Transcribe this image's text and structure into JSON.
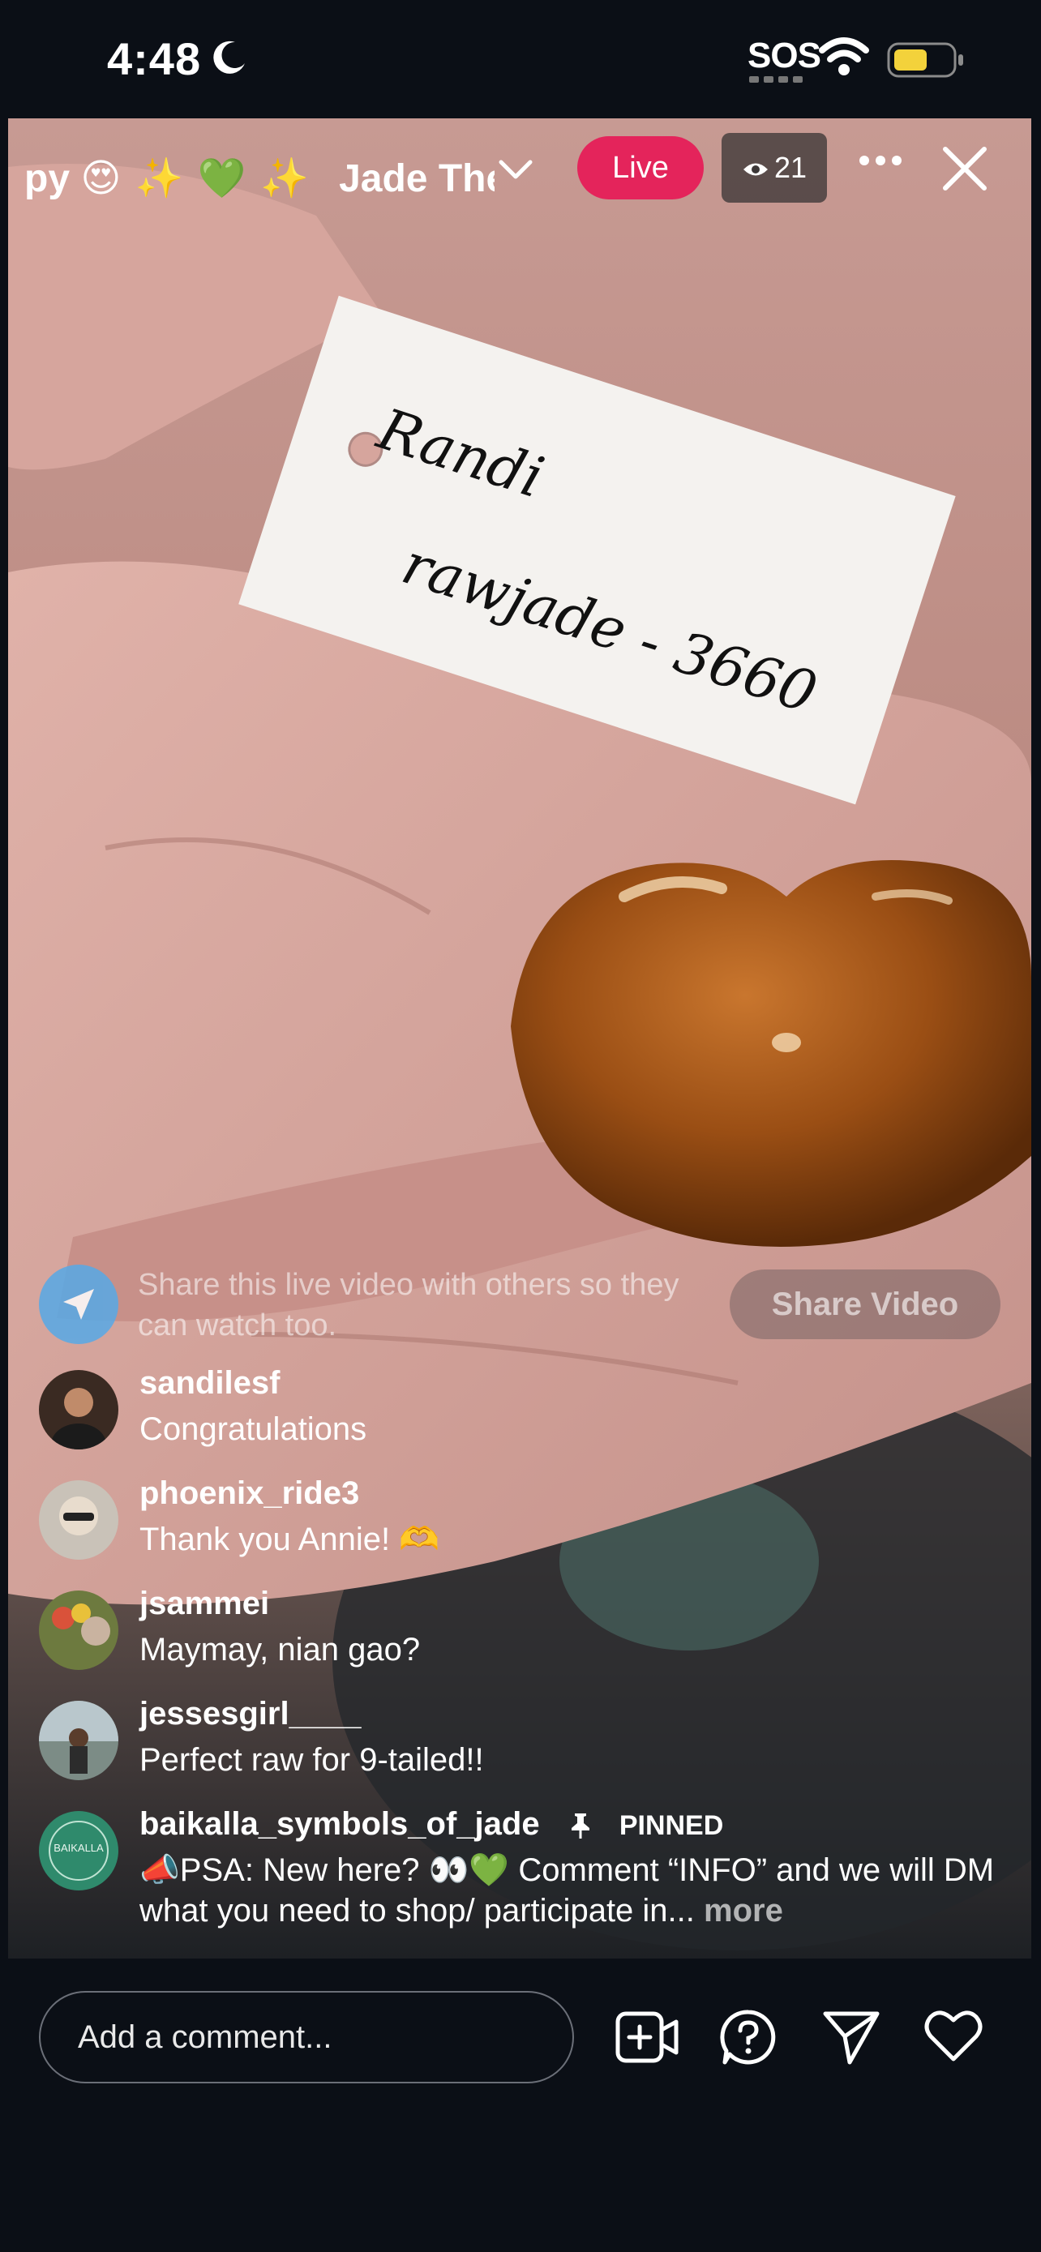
{
  "status_bar": {
    "time": "4:48",
    "sos": "SOS"
  },
  "live_header": {
    "scrolling_text": "py",
    "title": "Jade The",
    "live_label": "Live",
    "viewer_count": "21"
  },
  "video": {
    "tag_line_1": "Randi",
    "tag_line_2": "rawjade - 3660"
  },
  "share_prompt": {
    "text": "Share this live video with others so they can watch too.",
    "button": "Share Video"
  },
  "comments": [
    {
      "user": "sandilesf",
      "message": "Congratulations",
      "avatar_color": "#3a2a22"
    },
    {
      "user": "phoenix_ride3",
      "message": "Thank you Annie! 🫶",
      "avatar_color": "#c9c2b8"
    },
    {
      "user": "jsammei",
      "message": "Maymay, nian gao?",
      "avatar_color": "#6d7a3f"
    },
    {
      "user": "jessesgirl____",
      "message": "Perfect raw for 9-tailed!!",
      "avatar_color": "#7c8c86"
    },
    {
      "user": "baikalla_symbols_of_jade",
      "pinned_label": "PINNED",
      "message": "📣PSA: New here? 👀💚 Comment “INFO” and we will DM what you need to shop/ participate in...",
      "more": "more",
      "avatar_color": "#2f8a6c",
      "avatar_text": "BAIKALLA"
    }
  ],
  "bottom_bar": {
    "comment_placeholder": "Add a comment..."
  },
  "colors": {
    "live_badge": "#e4245b",
    "background": "#0b0f16",
    "share_icon": "#57a9e6"
  }
}
